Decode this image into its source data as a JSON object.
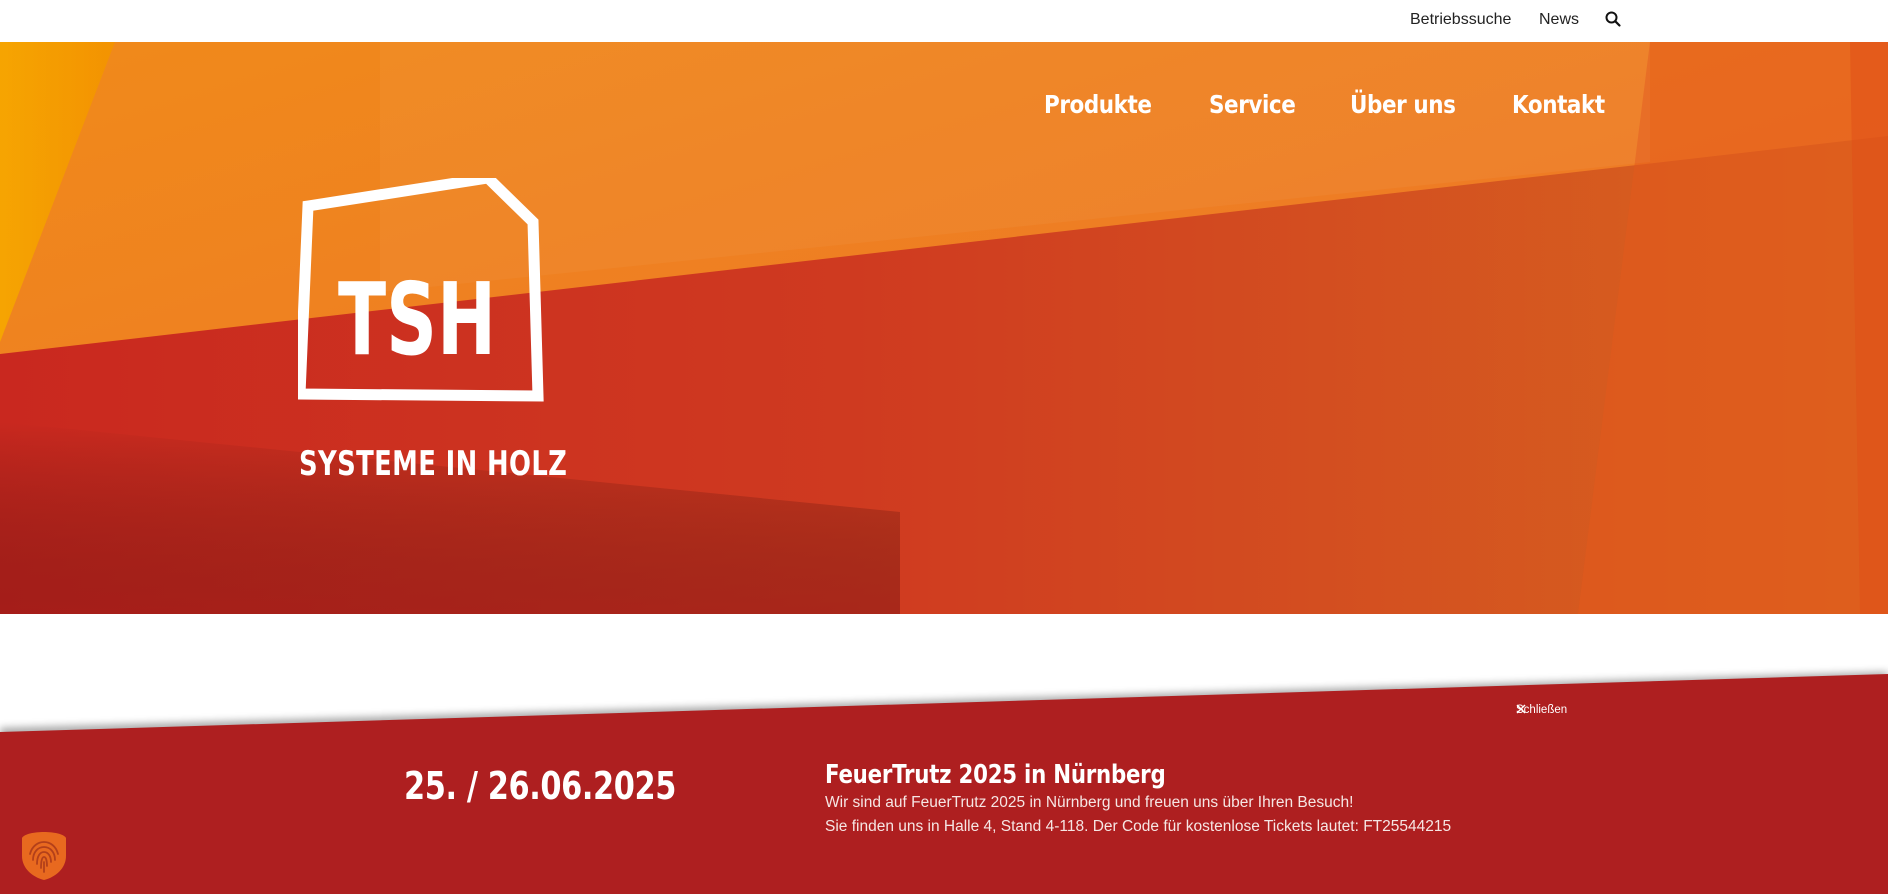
{
  "topbar": {
    "links": [
      {
        "label": "Betriebssuche"
      },
      {
        "label": "News"
      }
    ],
    "search_icon": "search-icon"
  },
  "nav": {
    "items": [
      {
        "label": "Produkte"
      },
      {
        "label": "Service"
      },
      {
        "label": "Über uns"
      },
      {
        "label": "Kontakt"
      }
    ]
  },
  "brand": {
    "logo_text": "TSH",
    "tagline": "SYSTEME IN HOLZ"
  },
  "announcement": {
    "close_label": "Schließen",
    "date": "25. / 26.06.2025",
    "title": "FeuerTrutz 2025 in Nürnberg",
    "line1": "Wir sind auf FeuerTrutz 2025 in Nürnberg und freuen uns über Ihren Besuch!",
    "line2": "Sie finden uns in Halle 4, Stand 4-118. Der Code für kostenlose Tickets lautet: FT25544215"
  },
  "colors": {
    "announcement_bg": "#ae1f20",
    "hero_orange": "#ee7a1e",
    "hero_red": "#c82a22",
    "hero_yellow": "#f4a000"
  },
  "icons": {
    "close": "close-icon",
    "cookie": "fingerprint-icon"
  }
}
